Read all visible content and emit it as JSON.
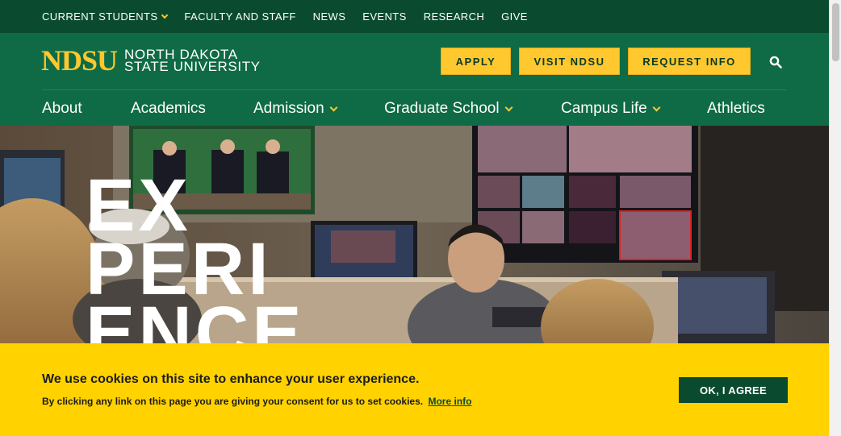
{
  "utility_nav": [
    "CURRENT STUDENTS",
    "FACULTY AND STAFF",
    "NEWS",
    "EVENTS",
    "RESEARCH",
    "GIVE"
  ],
  "logo": {
    "mark": "NDSU",
    "line1": "NORTH DAKOTA",
    "line2": "STATE UNIVERSITY"
  },
  "cta": {
    "apply": "APPLY",
    "visit": "VISIT NDSU",
    "request": "REQUEST INFO"
  },
  "primary_nav": [
    "About",
    "Academics",
    "Admission",
    "Graduate School",
    "Campus Life",
    "Athletics"
  ],
  "hero": {
    "line1": "EX",
    "line2": "PERI",
    "line3": "ENCE"
  },
  "cookie": {
    "title": "We use cookies on this site to enhance your user experience.",
    "text": "By clicking any link on this page you are giving your consent for us to set cookies.",
    "link": "More info",
    "button": "OK, I AGREE"
  },
  "colors": {
    "brand_green": "#0f6b45",
    "dark_green": "#0a4b30",
    "brand_gold": "#ffc82e",
    "banner_yellow": "#ffd200"
  },
  "icons": [
    "chevron-down-icon",
    "search-icon"
  ]
}
